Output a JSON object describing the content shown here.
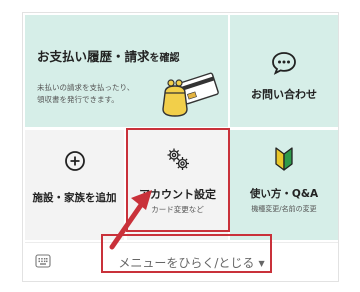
{
  "payment": {
    "title": "お支払い履歴・請求",
    "title_suffix": "を確認",
    "desc_line1": "未払いの請求を支払ったり、",
    "desc_line2": "領収書を発行できます。",
    "illustration_icon": "wallet-card-icon"
  },
  "contact": {
    "label": "お問い合わせ",
    "icon": "speech-bubble-icon"
  },
  "add_facility": {
    "label": "施設・家族を追加",
    "icon": "plus-circle-icon"
  },
  "account": {
    "label": "アカウント設定",
    "sub": "カード変更など",
    "icon": "gears-icon"
  },
  "usage": {
    "label": "使い方・Q&A",
    "sub": "機種変更/名前の変更",
    "icon": "beginner-mark-icon"
  },
  "menu_bar": {
    "toggle_label": "メニューをひらく/とじる",
    "keyboard_icon": "keyboard-icon",
    "caret_icon": "caret-down-icon"
  },
  "colors": {
    "mint": "#d6eee8",
    "gray": "#f3f3f3",
    "highlight_red": "#c9313a",
    "beginner_green": "#2e9a4a",
    "beginner_yellow": "#e8c72a"
  }
}
